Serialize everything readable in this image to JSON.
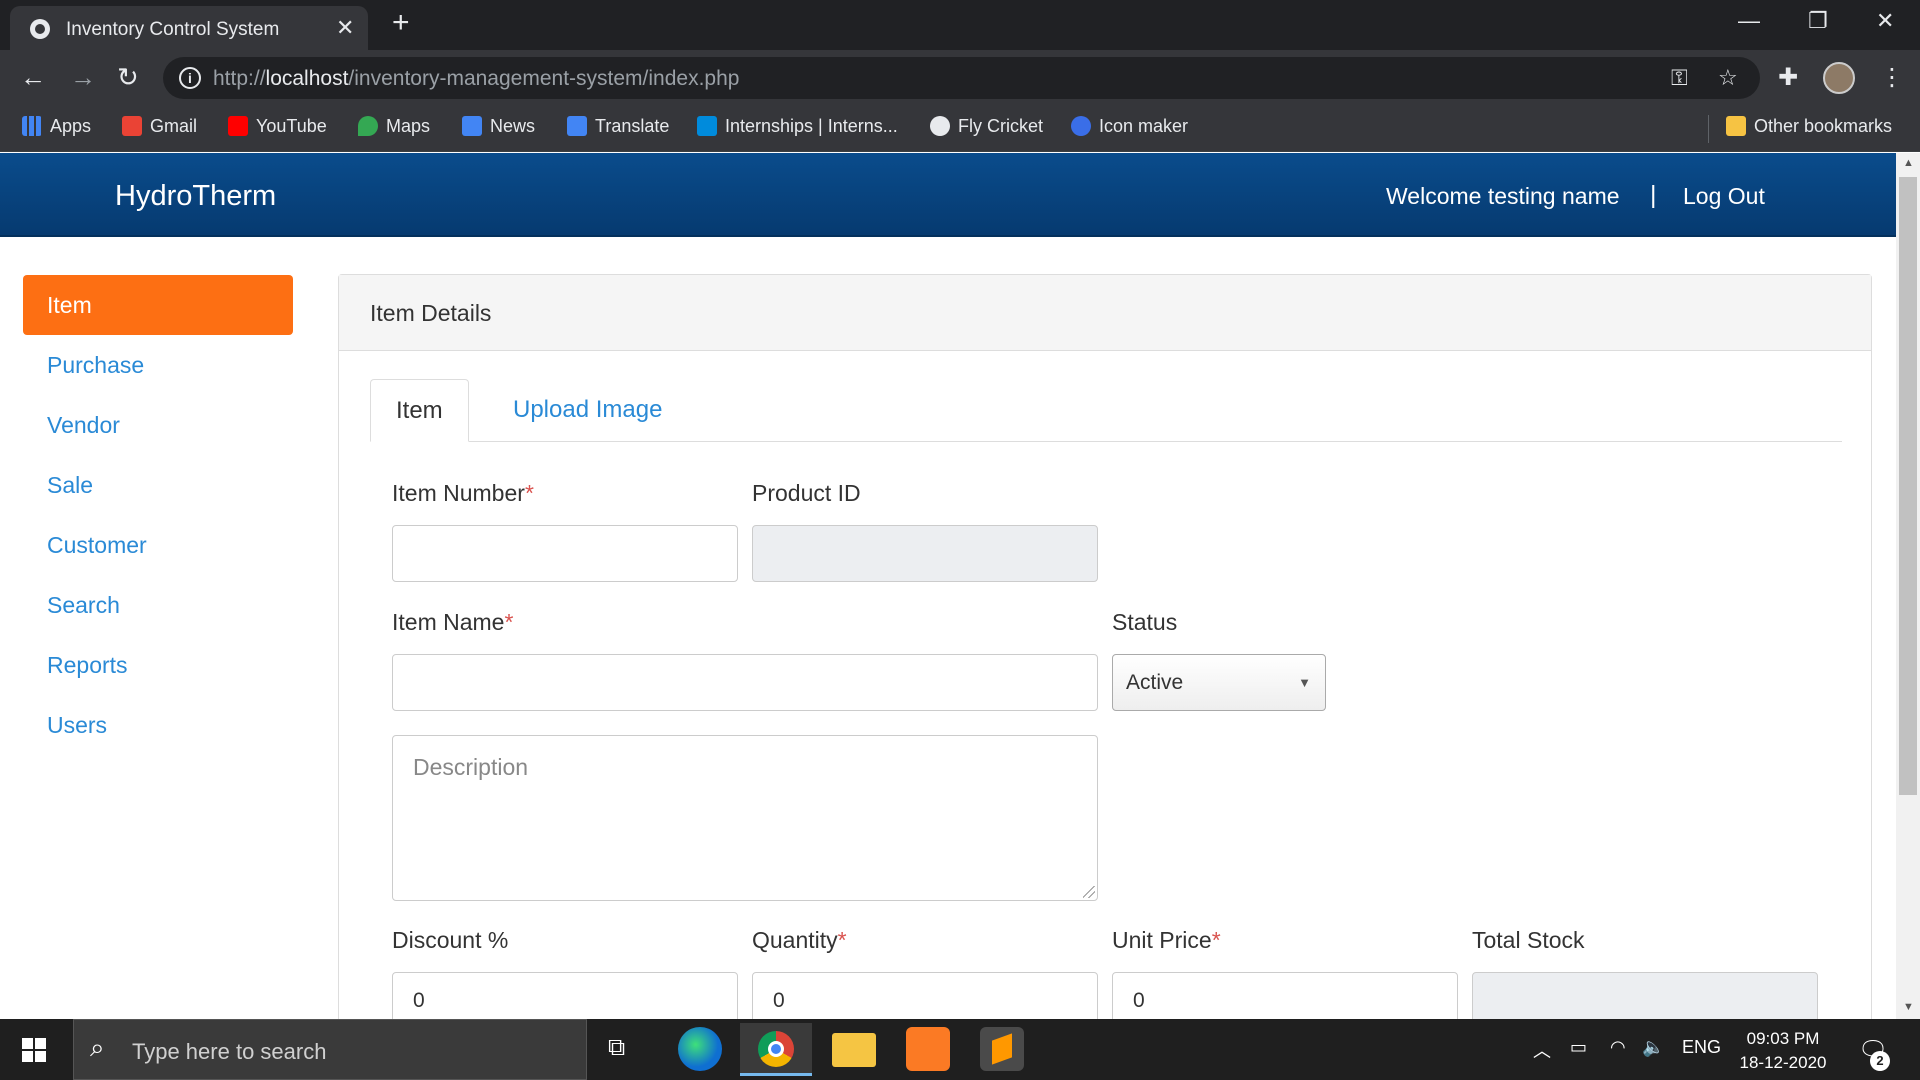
{
  "browser": {
    "tab_title": "Inventory Control System",
    "tab_close": "✕",
    "new_tab": "+",
    "url_prefix": "http://",
    "url_host": "localhost",
    "url_path": "/inventory-management-system/index.php",
    "bookmarks": [
      "Apps",
      "Gmail",
      "YouTube",
      "Maps",
      "News",
      "Translate",
      "Internships | Interns...",
      "Fly Cricket",
      "Icon maker"
    ],
    "other_bookmarks": "Other bookmarks"
  },
  "navbar": {
    "brand": "HydroTherm",
    "welcome": "Welcome testing name",
    "separator": "|",
    "logout": "Log Out"
  },
  "sidebar": {
    "items": [
      "Item",
      "Purchase",
      "Vendor",
      "Sale",
      "Customer",
      "Search",
      "Reports",
      "Users"
    ],
    "active": "Item"
  },
  "panel": {
    "heading": "Item Details",
    "tabs": [
      "Item",
      "Upload Image"
    ],
    "fields": {
      "item_number": {
        "label": "Item Number",
        "value": ""
      },
      "product_id": {
        "label": "Product ID",
        "value": ""
      },
      "item_name": {
        "label": "Item Name",
        "value": ""
      },
      "status": {
        "label": "Status",
        "value": "Active"
      },
      "description": {
        "placeholder": "Description"
      },
      "discount": {
        "label": "Discount %",
        "value": "0"
      },
      "quantity": {
        "label": "Quantity",
        "value": "0"
      },
      "unit_price": {
        "label": "Unit Price",
        "value": "0"
      },
      "total_stock": {
        "label": "Total Stock",
        "value": ""
      }
    },
    "required_mark": "*"
  },
  "taskbar": {
    "search_placeholder": "Type here to search",
    "language": "ENG",
    "time": "09:03 PM",
    "date": "18-12-2020",
    "notification_count": "2"
  }
}
